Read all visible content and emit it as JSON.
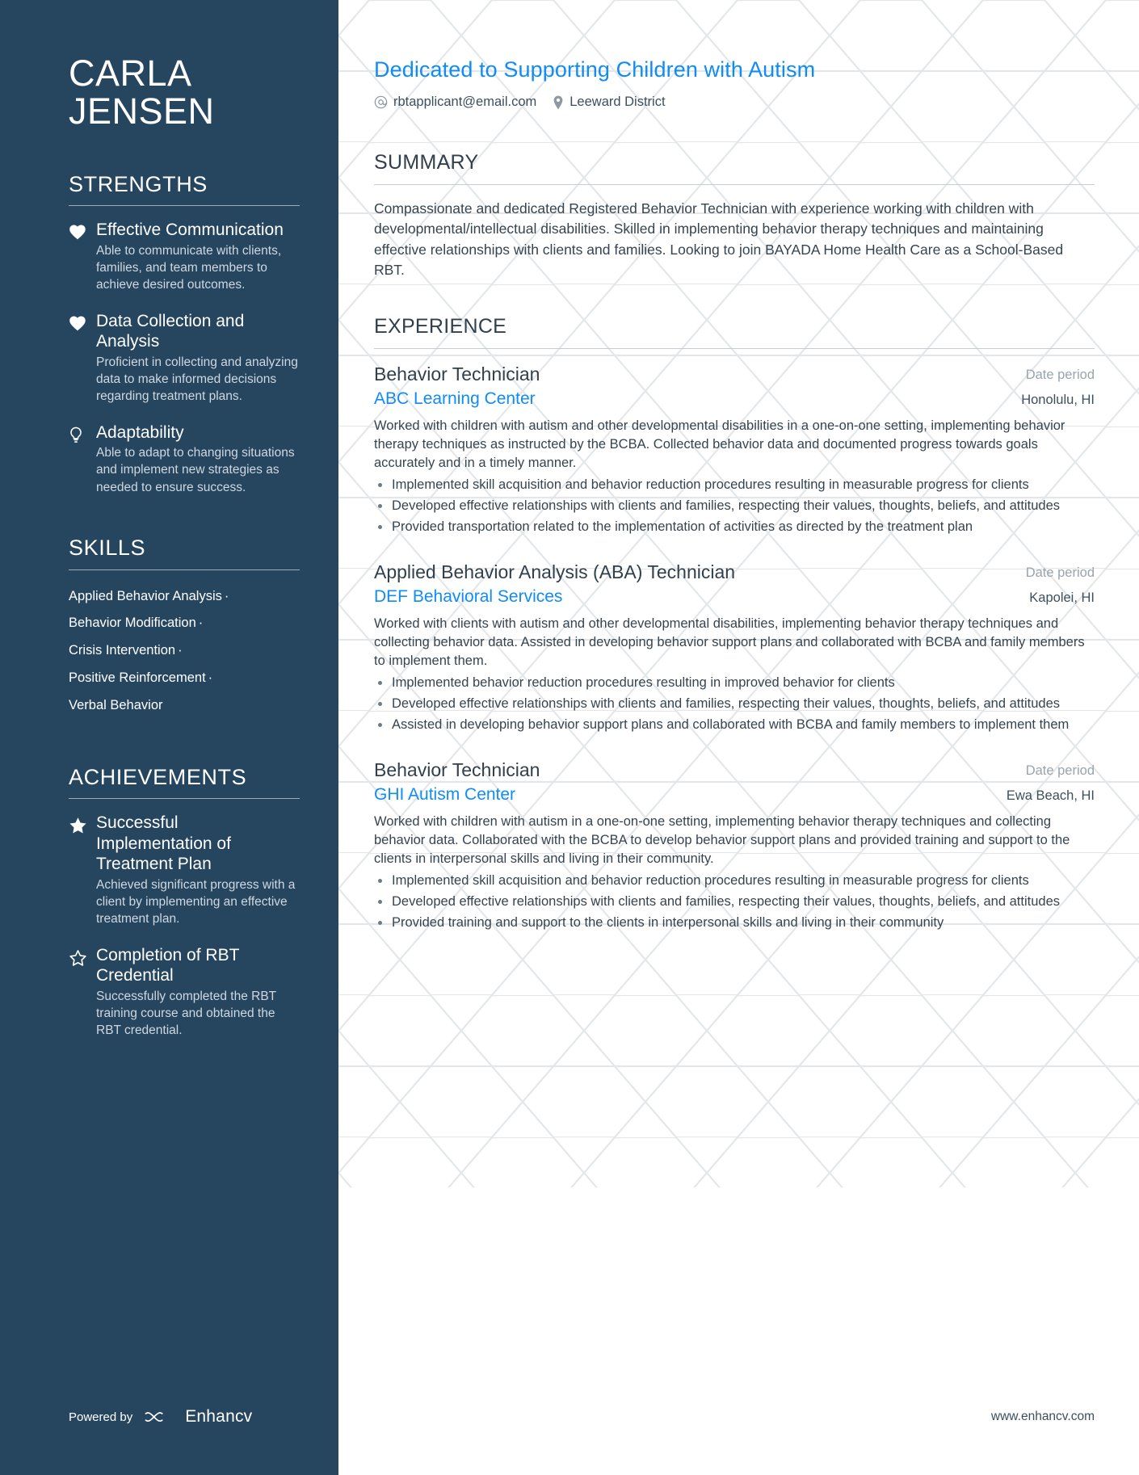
{
  "sidebar": {
    "first_name": "CARLA",
    "last_name": "JENSEN",
    "strengths": {
      "heading": "STRENGTHS",
      "items": [
        {
          "icon": "heart-icon",
          "title": "Effective Communication",
          "desc": "Able to communicate with clients, families, and team members to achieve desired outcomes."
        },
        {
          "icon": "heart-icon",
          "title": "Data Collection and Analysis",
          "desc": "Proficient in collecting and analyzing data to make informed decisions regarding treatment plans."
        },
        {
          "icon": "lightbulb-icon",
          "title": "Adaptability",
          "desc": "Able to adapt to changing situations and implement new strategies as needed to ensure success."
        }
      ]
    },
    "skills": {
      "heading": "SKILLS",
      "items": [
        {
          "label": "Applied Behavior Analysis",
          "sep": "·"
        },
        {
          "label": "Behavior Modification",
          "sep": "·"
        },
        {
          "label": "Crisis Intervention",
          "sep": "·"
        },
        {
          "label": "Positive Reinforcement",
          "sep": "·"
        },
        {
          "label": "Verbal Behavior",
          "sep": ""
        }
      ]
    },
    "achievements": {
      "heading": "ACHIEVEMENTS",
      "items": [
        {
          "icon": "star-filled-icon",
          "title": "Successful Implementation of Treatment Plan",
          "desc": "Achieved significant progress with a client by implementing an effective treatment plan."
        },
        {
          "icon": "star-outline-icon",
          "title": "Completion of RBT Credential",
          "desc": "Successfully completed the RBT training course and obtained the RBT credential."
        }
      ]
    },
    "footer": {
      "powered_by": "Powered by",
      "brand": "Enhancv"
    }
  },
  "main": {
    "headline": "Dedicated to Supporting Children with Autism",
    "contacts": [
      {
        "icon": "at-icon",
        "value": "rbtapplicant@email.com"
      },
      {
        "icon": "location-pin-icon",
        "value": "Leeward District"
      }
    ],
    "summary": {
      "heading": "SUMMARY",
      "text": "Compassionate and dedicated Registered Behavior Technician with experience working with children with developmental/intellectual disabilities. Skilled in implementing behavior therapy techniques and maintaining effective relationships with clients and families. Looking to join BAYADA Home Health Care as a School-Based RBT."
    },
    "experience": {
      "heading": "EXPERIENCE",
      "jobs": [
        {
          "title": "Behavior Technician",
          "date": "Date period",
          "company": "ABC Learning Center",
          "location": "Honolulu, HI",
          "desc": "Worked with children with autism and other developmental disabilities in a one-on-one setting, implementing behavior therapy techniques as instructed by the BCBA. Collected behavior data and documented progress towards goals accurately and in a timely manner.",
          "bullets": [
            "Implemented skill acquisition and behavior reduction procedures resulting in measurable progress for clients",
            "Developed effective relationships with clients and families, respecting their values, thoughts, beliefs, and attitudes",
            "Provided transportation related to the implementation of activities as directed by the treatment plan"
          ]
        },
        {
          "title": "Applied Behavior Analysis (ABA) Technician",
          "date": "Date period",
          "company": "DEF Behavioral Services",
          "location": "Kapolei, HI",
          "desc": "Worked with clients with autism and other developmental disabilities, implementing behavior therapy techniques and collecting behavior data. Assisted in developing behavior support plans and collaborated with BCBA and family members to implement them.",
          "bullets": [
            "Implemented behavior reduction procedures resulting in improved behavior for clients",
            "Developed effective relationships with clients and families, respecting their values, thoughts, beliefs, and attitudes",
            "Assisted in developing behavior support plans and collaborated with BCBA and family members to implement them"
          ]
        },
        {
          "title": "Behavior Technician",
          "date": "Date period",
          "company": "GHI Autism Center",
          "location": "Ewa Beach, HI",
          "desc": "Worked with children with autism in a one-on-one setting, implementing behavior therapy techniques and collecting behavior data. Collaborated with the BCBA to develop behavior support plans and provided training and support to the clients in interpersonal skills and living in their community.",
          "bullets": [
            "Implemented skill acquisition and behavior reduction procedures resulting in measurable progress for clients",
            "Developed effective relationships with clients and families, respecting their values, thoughts, beliefs, and attitudes",
            "Provided training and support to the clients in interpersonal skills and living in their community"
          ]
        }
      ]
    },
    "site_url": "www.enhancv.com"
  },
  "colors": {
    "sidebar_bg": "#26455f",
    "accent_blue": "#0f8cf5",
    "body_text": "#36444f",
    "muted": "#9aa4ac"
  }
}
